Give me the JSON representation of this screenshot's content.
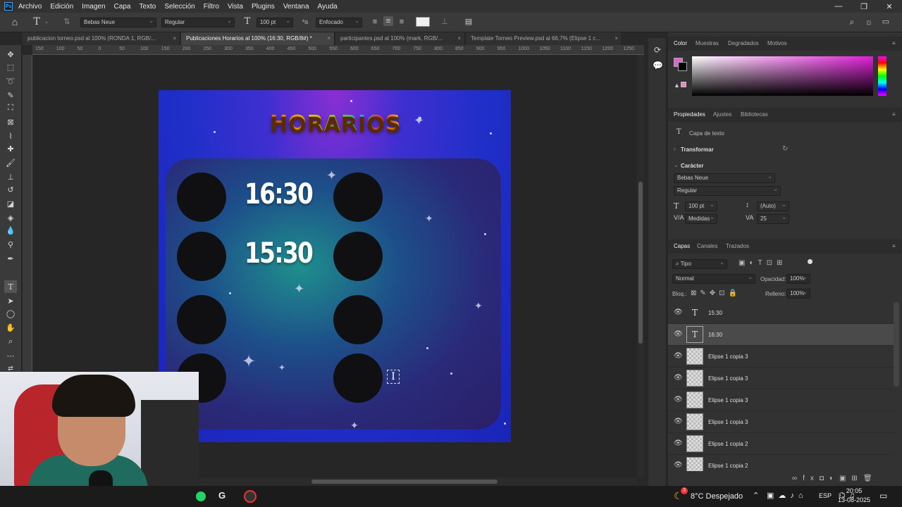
{
  "menu": {
    "items": [
      "Archivo",
      "Edición",
      "Imagen",
      "Capa",
      "Texto",
      "Selección",
      "Filtro",
      "Vista",
      "Plugins",
      "Ventana",
      "Ayuda"
    ]
  },
  "options": {
    "font_family": "Bebas Neue",
    "font_style": "Regular",
    "font_size": "100 pt",
    "antialias": "Enfocado"
  },
  "tabs": [
    {
      "label": "publicacion torneo.psd al 100% (RONDA 1, RGB/..."
    },
    {
      "label": "Publicaciones Horarios al 100% (16:30, RGB/8#) *"
    },
    {
      "label": "participantes.psd al 100% (mark, RGB/..."
    },
    {
      "label": "Template Torneo Preview.psd al 66,7% (Elipse 1 c..."
    }
  ],
  "ruler_labels": [
    "150",
    "100",
    "50",
    "0",
    "50",
    "100",
    "150",
    "200",
    "250",
    "300",
    "350",
    "400",
    "450",
    "500",
    "550",
    "600",
    "650",
    "700",
    "750",
    "800",
    "850",
    "900",
    "950",
    "1000",
    "1050",
    "1100",
    "1150",
    "1200",
    "1250"
  ],
  "artwork": {
    "title": "HORARIOS",
    "times": [
      "16:30",
      "15:30"
    ]
  },
  "color_panel": {
    "tabs": [
      "Color",
      "Muestras",
      "Degradados",
      "Motivos"
    ],
    "foreground": "#e060e0",
    "background": "#000000"
  },
  "properties": {
    "tabs": [
      "Propiedades",
      "Ajustes",
      "Bibliotecas"
    ],
    "layer_type": "Capa de texto",
    "transform_label": "Transformar",
    "character_label": "Carácter",
    "font_family": "Bebas Neue",
    "font_style": "Regular",
    "size": "100 pt",
    "leading": "(Auto)",
    "kerning": "Medidas",
    "tracking": "25"
  },
  "layers": {
    "tabs": [
      "Capas",
      "Canales",
      "Trazados"
    ],
    "filter": "Tipo",
    "blend_mode": "Normal",
    "opacity_label": "Opacidad:",
    "opacity": "100%",
    "lock_label": "Bloq.:",
    "fill_label": "Relleno:",
    "fill": "100%",
    "rows": [
      {
        "name": "15:30",
        "kind": "text"
      },
      {
        "name": "16:30",
        "kind": "text",
        "selected": true
      },
      {
        "name": "Elipse 1 copia 3",
        "kind": "shape"
      },
      {
        "name": "Elipse 1 copia 3",
        "kind": "shape"
      },
      {
        "name": "Elipse 1 copia 3",
        "kind": "shape"
      },
      {
        "name": "Elipse 1 copia 3",
        "kind": "shape"
      },
      {
        "name": "Elipse 1 copia 2",
        "kind": "shape"
      },
      {
        "name": "Elipse 1 copia 2",
        "kind": "shape"
      }
    ]
  },
  "taskbar": {
    "weather": "8°C Despejado",
    "language": "ESP",
    "time": "20:05",
    "date": "13-08-2025",
    "notification_count": "3"
  }
}
